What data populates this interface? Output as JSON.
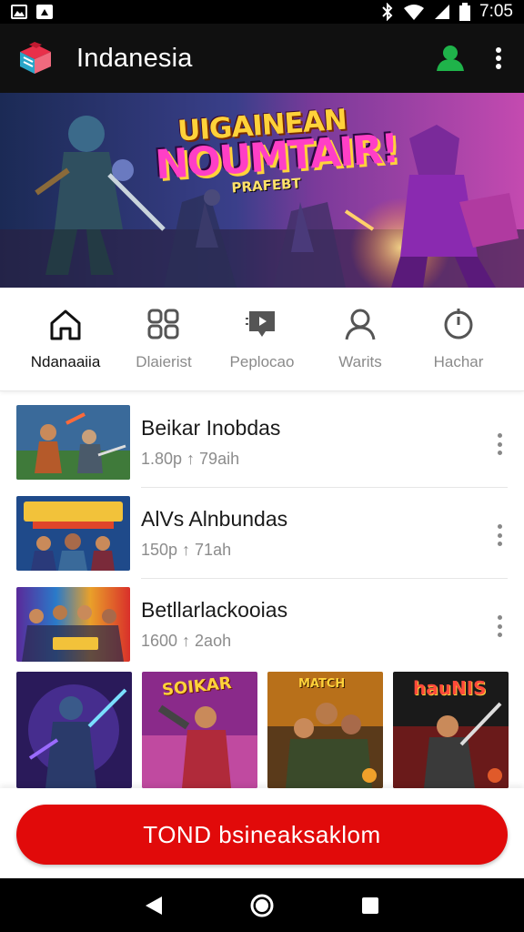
{
  "status_bar": {
    "time": "7:05",
    "icons": [
      "gallery-icon",
      "notification-icon",
      "bluetooth-icon",
      "wifi-icon",
      "signal-icon",
      "battery-icon"
    ]
  },
  "app_bar": {
    "title": "Indanesia",
    "profile_icon": "person-icon",
    "menu_icon": "more-vert-icon",
    "profile_color": "#1fb34a"
  },
  "banner": {
    "line1": "UIGAINEAN",
    "line2": "NOUMTAIR!",
    "line3": "PRAFEBT"
  },
  "nav_tabs": [
    {
      "label": "Ndanaaiia",
      "icon": "home-icon",
      "active": true
    },
    {
      "label": "Dlaierist",
      "icon": "grid-icon",
      "active": false
    },
    {
      "label": "Peplocao",
      "icon": "video-icon",
      "active": false
    },
    {
      "label": "Warits",
      "icon": "person-outline-icon",
      "active": false
    },
    {
      "label": "Hachar",
      "icon": "timer-icon",
      "active": false
    }
  ],
  "list_items": [
    {
      "title": "Beikar Inobdas",
      "subtitle": "1.80p ↑ 79aih"
    },
    {
      "title": "AlVs Alnbundas",
      "subtitle": "150p ↑ 71ah"
    },
    {
      "title": "Betllarlackooias",
      "subtitle": "1600 ↑ 2aoh"
    }
  ],
  "grid_tiles": [
    {
      "name": "tile-1",
      "caption": ""
    },
    {
      "name": "tile-2",
      "caption": "SOIKAR"
    },
    {
      "name": "tile-3",
      "caption": "MATCH"
    },
    {
      "name": "tile-4",
      "caption": "hauNIS"
    }
  ],
  "cta": {
    "label": "TOND bsineaksaklom",
    "color": "#e10a0a"
  },
  "colors": {
    "accent": "#e10a0a",
    "app_bar_bg": "#101010",
    "profile_green": "#1fb34a"
  }
}
